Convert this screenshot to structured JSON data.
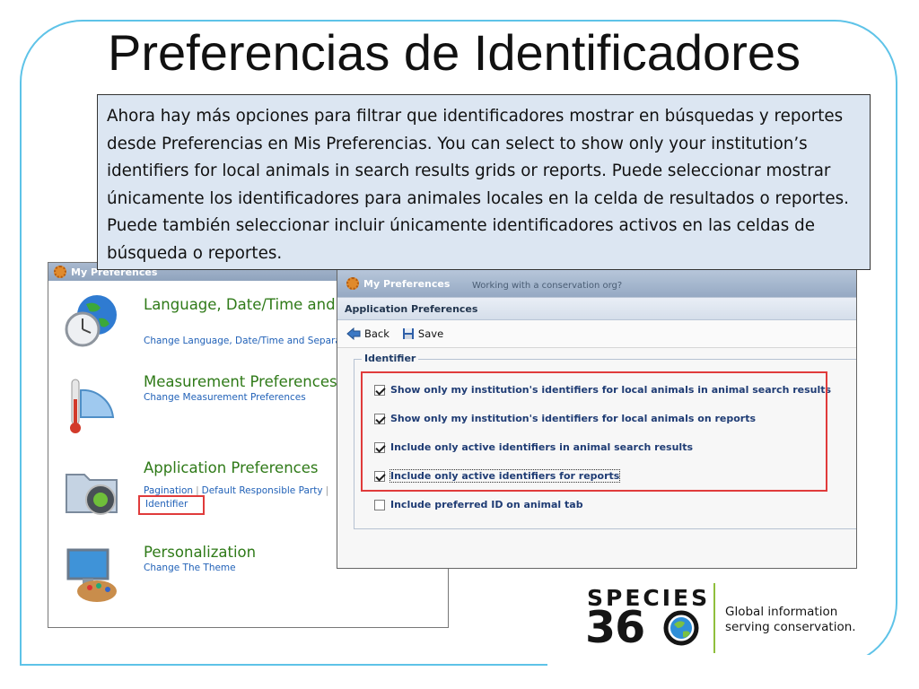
{
  "slide": {
    "title": "Preferencias de Identificadores",
    "callout": "Ahora hay más opciones para filtrar que identificadores mostrar en búsquedas y reportes desde Preferencias en Mis Preferencias. You can select to show only your institution’s identifiers for local animals in search results grids or reports. Puede seleccionar mostrar únicamente los identificadores para animales locales en la celda de resultados o reportes. Puede también seleccionar incluir únicamente identificadores activos en las celdas de búsqueda o reportes."
  },
  "back_window": {
    "title": "My Preferences",
    "items": [
      {
        "title": "Language, Date/Time and Formats",
        "subtitle": "Change Language, Date/Time and Separa",
        "icon": "globe-clock-icon"
      },
      {
        "title": "Measurement Preferences",
        "subtitle": "Change Measurement Preferences",
        "icon": "thermometer-ruler-icon"
      },
      {
        "title": "Application Preferences",
        "links": [
          "Pagination",
          "Default Responsible Party",
          "Identifier"
        ],
        "icon": "folder-app-icon"
      },
      {
        "title": "Personalization",
        "subtitle": "Change The Theme",
        "icon": "monitor-palette-icon"
      }
    ]
  },
  "front_window": {
    "title": "My Preferences",
    "header_ghost_text": "Working with a conservation org?",
    "panel_title": "Application Preferences",
    "toolbar": {
      "back_label": "Back",
      "save_label": "Save"
    },
    "fieldset_legend": "Identifier",
    "options": [
      {
        "label": "Show only my institution's identifiers for local animals in animal search results",
        "checked": true
      },
      {
        "label": "Show only my institution's identifiers for local animals on reports",
        "checked": true
      },
      {
        "label": "Include only active identifiers in animal search results",
        "checked": true
      },
      {
        "label": "Include only active identifiers for reports",
        "checked": true
      },
      {
        "label": "Include preferred ID on animal tab",
        "checked": false
      }
    ]
  },
  "logo": {
    "wordmark": "SPECIES",
    "number_left": "36",
    "tagline_line1": "Global information",
    "tagline_line2": "serving conservation."
  },
  "colors": {
    "frame": "#5ec3e8",
    "callout_bg": "#dce6f2",
    "highlight": "#e03b3b",
    "pref_title": "#2f7a18",
    "link": "#2262b8",
    "option_text": "#1f3c74",
    "logo_accent": "#8fbf3c"
  }
}
